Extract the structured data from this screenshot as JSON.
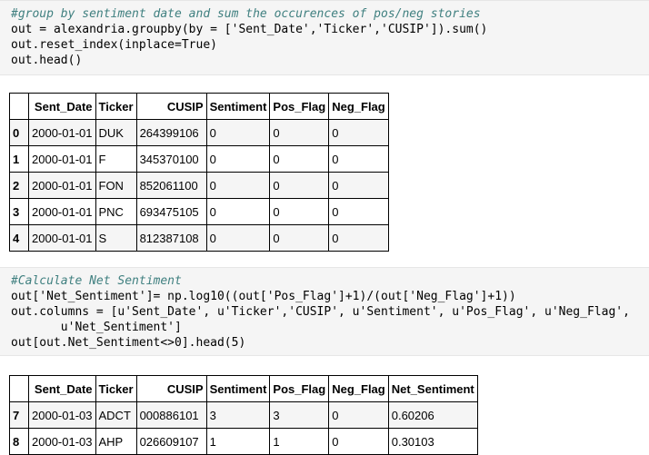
{
  "cell1": {
    "lines": [
      "#group by sentiment date and sum the occurences of pos/neg stories",
      "out = alexandria.groupby(by = ['Sent_Date','Ticker','CUSIP']).sum()",
      "out.reset_index(inplace=True)",
      "out.head()"
    ]
  },
  "table1": {
    "columns": [
      "",
      "Sent_Date",
      "Ticker",
      "CUSIP",
      "Sentiment",
      "Pos_Flag",
      "Neg_Flag"
    ],
    "rows": [
      {
        "index": "0",
        "Sent_Date": "2000-01-01",
        "Ticker": "DUK",
        "CUSIP": "264399106",
        "Sentiment": "0",
        "Pos_Flag": "0",
        "Neg_Flag": "0"
      },
      {
        "index": "1",
        "Sent_Date": "2000-01-01",
        "Ticker": "F",
        "CUSIP": "345370100",
        "Sentiment": "0",
        "Pos_Flag": "0",
        "Neg_Flag": "0"
      },
      {
        "index": "2",
        "Sent_Date": "2000-01-01",
        "Ticker": "FON",
        "CUSIP": "852061100",
        "Sentiment": "0",
        "Pos_Flag": "0",
        "Neg_Flag": "0"
      },
      {
        "index": "3",
        "Sent_Date": "2000-01-01",
        "Ticker": "PNC",
        "CUSIP": "693475105",
        "Sentiment": "0",
        "Pos_Flag": "0",
        "Neg_Flag": "0"
      },
      {
        "index": "4",
        "Sent_Date": "2000-01-01",
        "Ticker": "S",
        "CUSIP": "812387108",
        "Sentiment": "0",
        "Pos_Flag": "0",
        "Neg_Flag": "0"
      }
    ]
  },
  "cell2": {
    "lines": [
      "#Calculate Net Sentiment",
      "out['Net_Sentiment']= np.log10((out['Pos_Flag']+1)/(out['Neg_Flag']+1))",
      "out.columns = [u'Sent_Date', u'Ticker','CUSIP', u'Sentiment', u'Pos_Flag', u'Neg_Flag',",
      "       u'Net_Sentiment']",
      "out[out.Net_Sentiment<>0].head(5)"
    ]
  },
  "table2": {
    "columns": [
      "",
      "Sent_Date",
      "Ticker",
      "CUSIP",
      "Sentiment",
      "Pos_Flag",
      "Neg_Flag",
      "Net_Sentiment"
    ],
    "rows": [
      {
        "index": "7",
        "Sent_Date": "2000-01-03",
        "Ticker": "ADCT",
        "CUSIP": "000886101",
        "Sentiment": "3",
        "Pos_Flag": "3",
        "Neg_Flag": "0",
        "Net_Sentiment": "0.60206"
      },
      {
        "index": "8",
        "Sent_Date": "2000-01-03",
        "Ticker": "AHP",
        "CUSIP": "026609107",
        "Sentiment": "1",
        "Pos_Flag": "1",
        "Neg_Flag": "0",
        "Net_Sentiment": "0.30103"
      }
    ]
  }
}
